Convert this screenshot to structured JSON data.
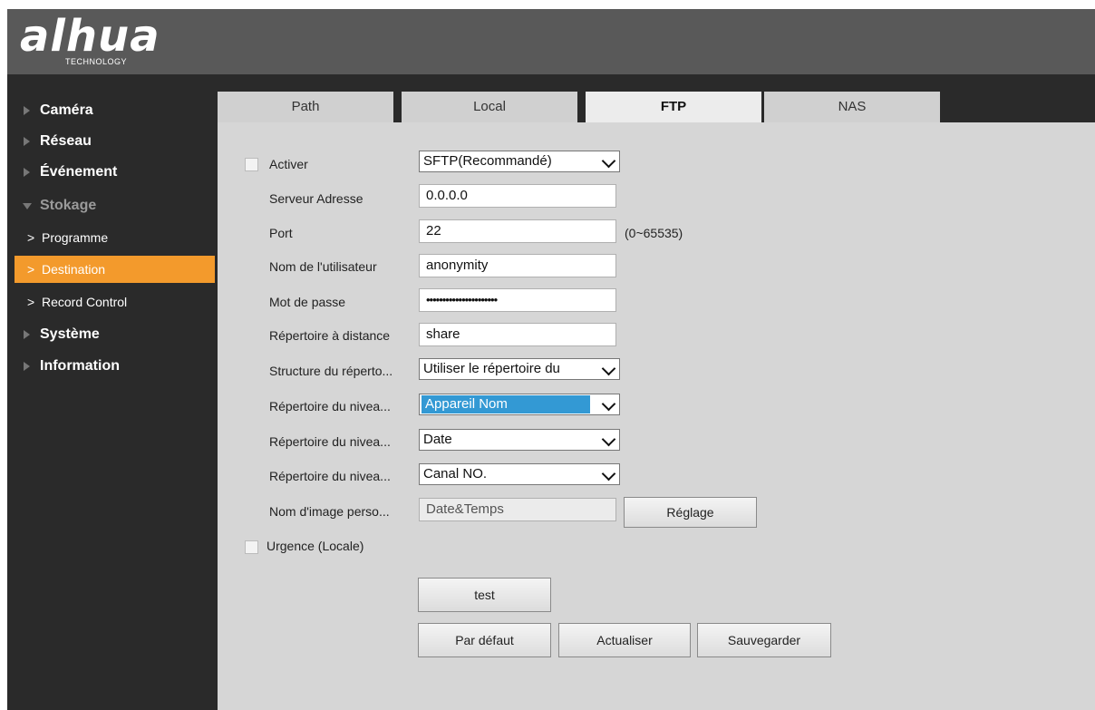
{
  "header": {
    "logo_text": "alhua",
    "logo_subtext": "TECHNOLOGY"
  },
  "sidebar": {
    "items": [
      {
        "label": "Caméra"
      },
      {
        "label": "Réseau"
      },
      {
        "label": "Événement"
      },
      {
        "label": "Stokage"
      }
    ],
    "sub_items": [
      {
        "label": "Programme"
      },
      {
        "label": "Destination"
      },
      {
        "label": "Record Control"
      }
    ],
    "items_after": [
      {
        "label": "Système"
      },
      {
        "label": "Information"
      }
    ],
    "active_sub_item": "Destination",
    "accent_color": "#f39a2c"
  },
  "tabs": [
    {
      "label": "Path"
    },
    {
      "label": "Local"
    },
    {
      "label": "FTP"
    },
    {
      "label": "NAS"
    }
  ],
  "active_tab": "FTP",
  "form": {
    "activer": {
      "label": "Activer",
      "checked": false,
      "protocol": "SFTP(Recommandé)"
    },
    "server": {
      "label": "Serveur Adresse",
      "value": "0.0.0.0"
    },
    "port": {
      "label": "Port",
      "value": "22",
      "hint": "(0~65535)"
    },
    "username": {
      "label": "Nom de l'utilisateur",
      "value": "anonymity"
    },
    "password": {
      "label": "Mot de passe",
      "value": "••••••••••••••••••••••"
    },
    "remote_dir": {
      "label": "Répertoire à distance",
      "value": "share"
    },
    "dir_structure": {
      "label": "Structure du réperto...",
      "value": "Utiliser le répertoire du"
    },
    "level1": {
      "label": "Répertoire du nivea...",
      "value": "Appareil Nom"
    },
    "level2": {
      "label": "Répertoire du nivea...",
      "value": "Date"
    },
    "level3": {
      "label": "Répertoire du nivea...",
      "value": "Canal NO."
    },
    "image_name": {
      "label": "Nom d'image perso...",
      "placeholder": "Date&Temps",
      "button": "Réglage"
    },
    "urgence": {
      "label": "Urgence (Locale)",
      "checked": false
    }
  },
  "buttons": {
    "test": "test",
    "default": "Par défaut",
    "refresh": "Actualiser",
    "save": "Sauvegarder"
  }
}
